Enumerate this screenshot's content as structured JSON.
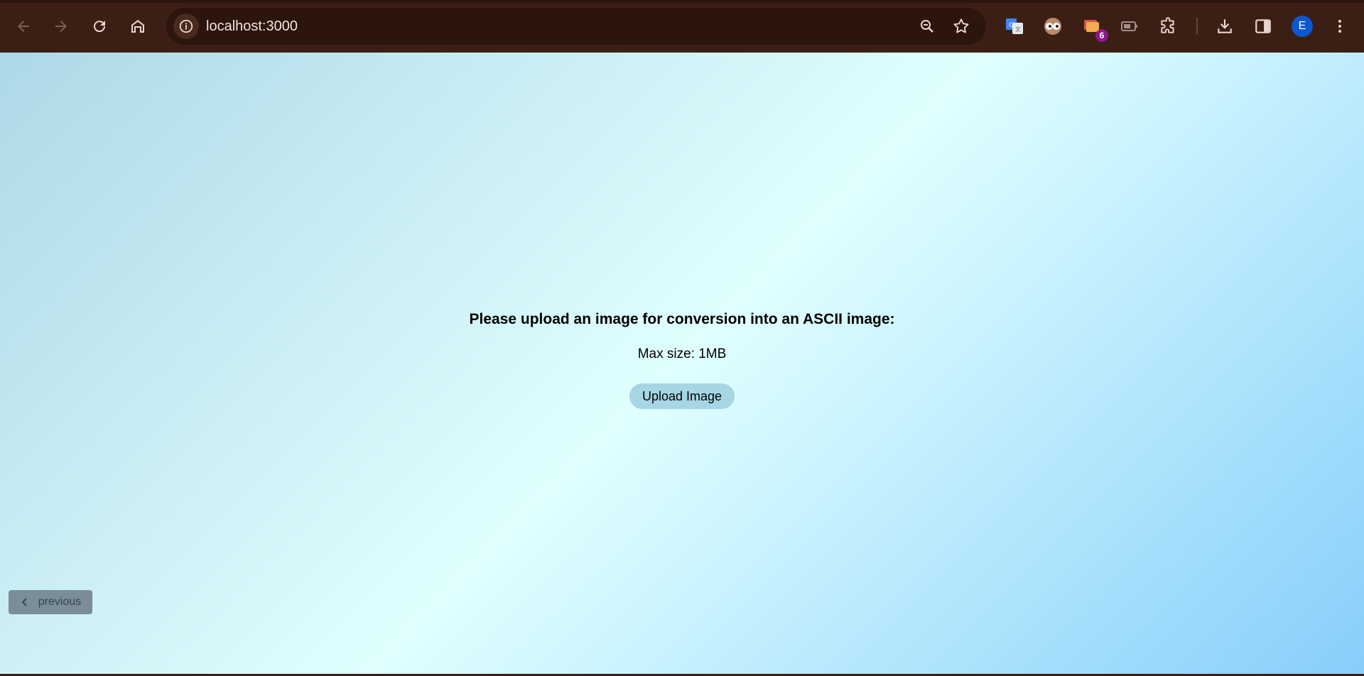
{
  "browser": {
    "url": "localhost:3000",
    "extension_badge": "6",
    "profile_initial": "E"
  },
  "page": {
    "heading": "Please upload an image for conversion into an ASCII image:",
    "max_size": "Max size: 1MB",
    "upload_label": "Upload Image",
    "previous_label": "previous"
  },
  "colors": {
    "toolbar": "#3c1f14",
    "gradient_start": "#add8e6",
    "gradient_mid": "#e0ffff",
    "gradient_end": "#87cefa",
    "upload_button": "#a6d5e3",
    "previous_button": "#7a8d99"
  },
  "icons": [
    "back-arrow-icon",
    "forward-arrow-icon",
    "reload-icon",
    "home-icon",
    "info-icon",
    "zoom-icon",
    "star-icon",
    "translate-extension-icon",
    "eyes-extension-icon",
    "gallery-extension-icon",
    "battery-extension-icon",
    "puzzle-extensions-icon",
    "download-icon",
    "side-panel-icon",
    "more-vert-icon",
    "chevron-left-icon"
  ]
}
